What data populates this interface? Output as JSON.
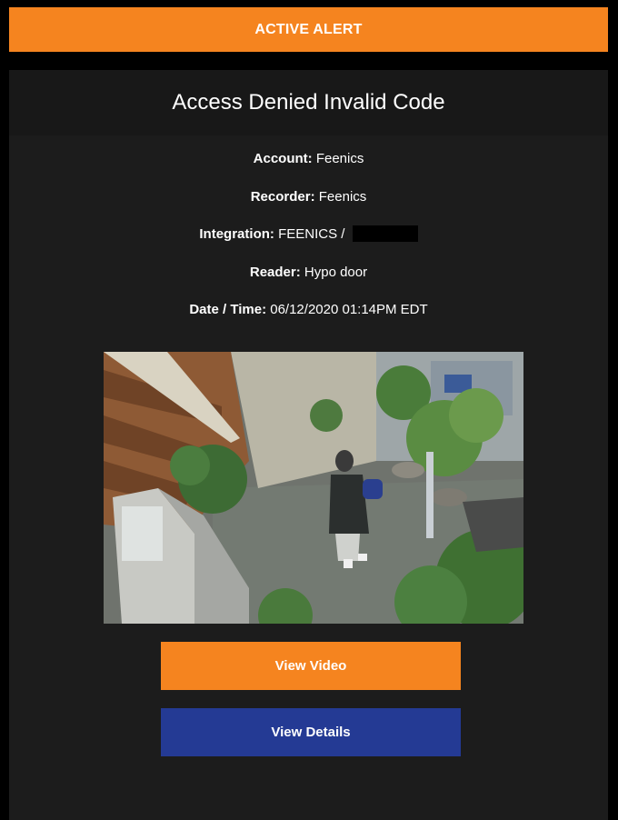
{
  "alert": {
    "label": "ACTIVE ALERT",
    "color": "#f5841f"
  },
  "event": {
    "title": "Access Denied Invalid Code"
  },
  "fields": {
    "account": {
      "label": "Account:",
      "value": "Feenics"
    },
    "recorder": {
      "label": "Recorder:",
      "value": "Feenics"
    },
    "integration": {
      "label": "Integration:",
      "value": "FEENICS /"
    },
    "reader": {
      "label": "Reader:",
      "value": "Hypo door"
    },
    "datetime": {
      "label": "Date / Time:",
      "value": "06/12/2020 01:14PM EDT"
    }
  },
  "snapshot": {
    "description": "camera-snapshot"
  },
  "buttons": {
    "view_video": {
      "label": "View Video",
      "color": "#f5841f"
    },
    "view_details": {
      "label": "View Details",
      "color": "#243a94"
    }
  }
}
